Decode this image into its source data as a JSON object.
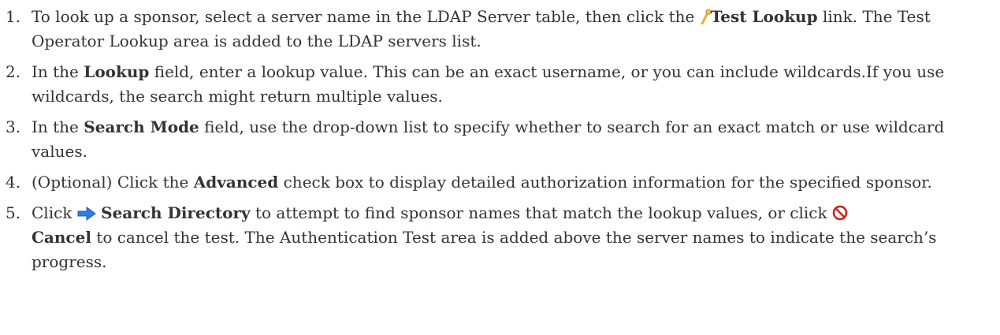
{
  "steps": [
    {
      "number": "1.",
      "text_a": "To look up a sponsor, select a server name in the LDAP Server table,  then click the ",
      "link_label": "Test Lookup",
      "text_b": " link. The Test Operator Lookup area is added to the LDAP servers list.",
      "icon": "key-icon"
    },
    {
      "number": "2.",
      "text_a": "In the ",
      "field_label": "Lookup",
      "text_b": " field, enter a lookup value. This can be an exact username, or you can include wildcards.If you use wildcards, the search might return multiple values."
    },
    {
      "number": "3.",
      "text_a": "In the ",
      "field_label": "Search Mode",
      "text_b": " field, use the drop-down list to specify whether to search for an exact match or use wildcard values."
    },
    {
      "number": "4.",
      "text_a": "(Optional) Click the ",
      "field_label": "Advanced",
      "text_b": " check box to display detailed authorization information for the specified sponsor."
    },
    {
      "number": "5.",
      "text_a": "Click ",
      "search_label": "Search Directory",
      "text_b": " to attempt to find sponsor names that match the lookup values, or click ",
      "cancel_label": "Cancel",
      "text_c": " to cancel the test. The Authentication Test area is added above the server names to indicate the search’s progress.",
      "icons": [
        "arrow-right-icon",
        "cancel-icon"
      ]
    }
  ],
  "colors": {
    "text": "#333333",
    "key_icon": "#e8b030",
    "arrow_icon": "#2c7de0",
    "cancel_icon": "#d0201a"
  }
}
